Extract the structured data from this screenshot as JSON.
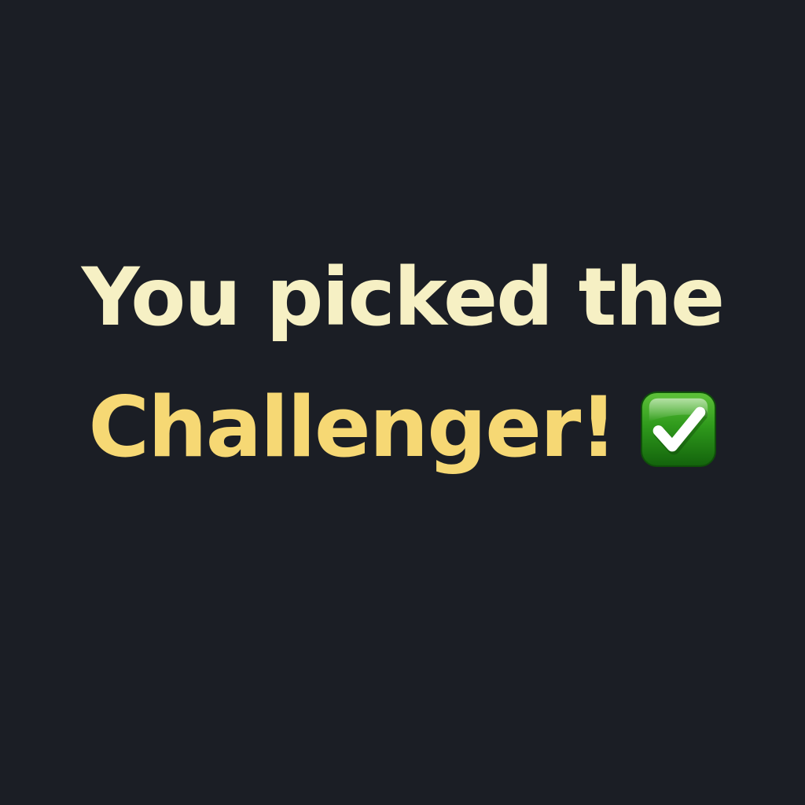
{
  "message": {
    "line1": "You picked the",
    "line2": "Challenger!",
    "icon": "check-mark-button-icon"
  },
  "colors": {
    "background": "#1b1e25",
    "line1_text": "#f6f0c4",
    "line2_text": "#f6d874",
    "icon_green": "#2e8b16",
    "icon_check": "#ffffff"
  }
}
